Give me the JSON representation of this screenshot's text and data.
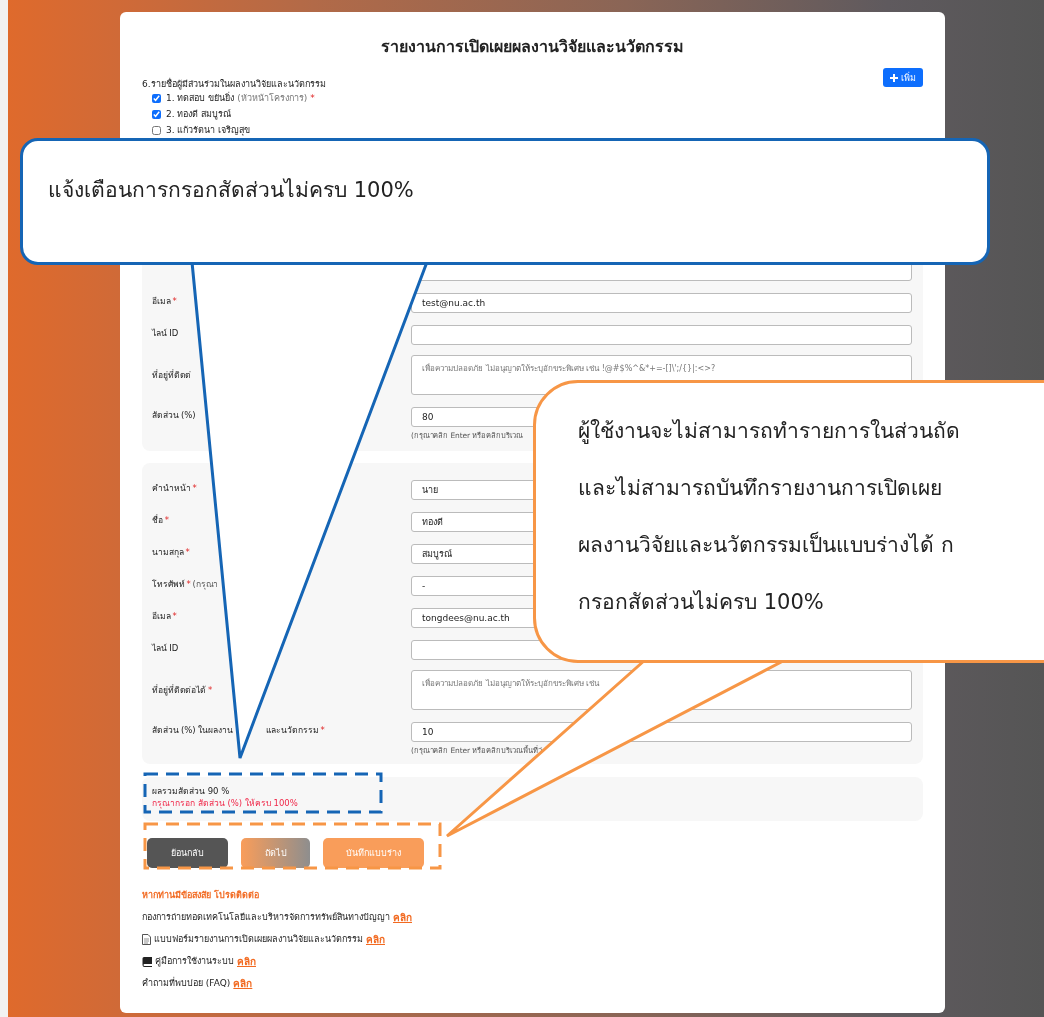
{
  "page_title": "รายงานการเปิดเผยผลงานวิจัยและนวัตกรรม",
  "participants": {
    "heading": "6.รายชื่อผู้มีส่วนร่วมในผลงานวิจัยและนวัตกรรม",
    "add_button": "เพิ่ม",
    "items": [
      {
        "name": "1. ทดสอบ ขยันยิ่ง",
        "role": "(หัวหน้าโครงการ)",
        "mark": "*",
        "checked": true
      },
      {
        "name": "2. ทองดี สมบูรณ์",
        "checked": true
      },
      {
        "name": "3. แก้วรัตนา เจริญสุข",
        "checked": false
      }
    ]
  },
  "panels": [
    {
      "rows": [
        {
          "kind": "input",
          "value": ""
        },
        {
          "kind": "input",
          "label": "อีเมล",
          "mark": "*",
          "value": "test@nu.ac.th"
        },
        {
          "kind": "input",
          "label": "ไลน์ ID",
          "value": ""
        },
        {
          "kind": "textarea",
          "label": "ที่อยู่ที่ติดต่",
          "placeholder": "เพื่อความปลอดภัย ไม่อนุญาตให้ระบุอักขระพิเศษ เช่น !@#$%^&*+=-[]\\';/{}|:<>?"
        },
        {
          "kind": "input",
          "label": "สัดส่วน (%)",
          "value": "80",
          "help": "(กรุณาคลิก Enter หรือคลิกบริเวณ"
        }
      ]
    },
    {
      "rows": [
        {
          "kind": "input",
          "label": "คำนำหน้า",
          "mark": "*",
          "value": "นาย"
        },
        {
          "kind": "input",
          "label": "ชื่อ",
          "mark": "*",
          "value": "ทองดี"
        },
        {
          "kind": "input",
          "label": "นามสกุล",
          "mark": "*",
          "value": "สมบูรณ์"
        },
        {
          "kind": "input",
          "label": "โทรศัพท์",
          "mark": "*",
          "note": "(กรุณา",
          "value": "-"
        },
        {
          "kind": "input",
          "label": "อีเมล",
          "mark": "*",
          "value": "tongdees@nu.ac.th"
        },
        {
          "kind": "input",
          "label": "ไลน์ ID",
          "value": ""
        },
        {
          "kind": "textarea",
          "label": "ที่อยู่ที่ติดต่อได้",
          "mark": "*",
          "placeholder": "เพื่อความปลอดภัย ไม่อนุญาตให้ระบุอักขระพิเศษ เช่น"
        },
        {
          "kind": "input",
          "label": "สัดส่วน (%) ในผลงาน",
          "label_continued": "และนวัตกรรม",
          "mark": "*",
          "value": "10",
          "help": "(กรุณาคลิก Enter หรือคลิกบริเวณพื้นที่ว่"
        }
      ]
    }
  ],
  "summary": {
    "total": "ผลรวมสัดส่วน 90 %",
    "warning": "กรุณากรอก สัดส่วน (%) ให้ครบ 100%"
  },
  "buttons": [
    {
      "label": "ย้อนกลับ",
      "kind": "back"
    },
    {
      "label": "ถัดไป",
      "kind": "next"
    },
    {
      "label": "บันทึกแบบร่าง",
      "kind": "draft"
    }
  ],
  "footer": {
    "heading": "หากท่านมีข้อสงสัย โปรดติดต่อ",
    "lines": [
      {
        "kind": "plain",
        "text": "กองการถ่ายทอดเทคโนโลยีและบริหารจัดการทรัพย์สินทางปัญญา",
        "link": "คลิก"
      },
      {
        "kind": "document",
        "text": "แบบฟอร์มรายงานการเปิดเผยผลงานวิจัยและนวัตกรรม",
        "link": "คลิก"
      },
      {
        "kind": "book",
        "text": "คู่มือการใช้งานระบบ",
        "link": "คลิก"
      },
      {
        "kind": "plain",
        "text": "คำถามที่พบบ่อย (FAQ)",
        "link": "คลิก"
      }
    ]
  },
  "callouts": [
    {
      "color": "#1565b5",
      "lines": [
        "แจ้งเตือนการกรอกสัดส่วนไม่ครบ 100%"
      ]
    },
    {
      "color": "#f79646",
      "lines": [
        "ผู้ใช้งานจะไม่สามารถทำรายการในส่วนถัด",
        "และไม่สามารถบันทึกรายงานการเปิดเผย",
        "ผลงานวิจัยและนวัตกรรมเป็นแบบร่างได้ ก",
        "กรอกสัดส่วนไม่ครบ 100%"
      ]
    }
  ]
}
